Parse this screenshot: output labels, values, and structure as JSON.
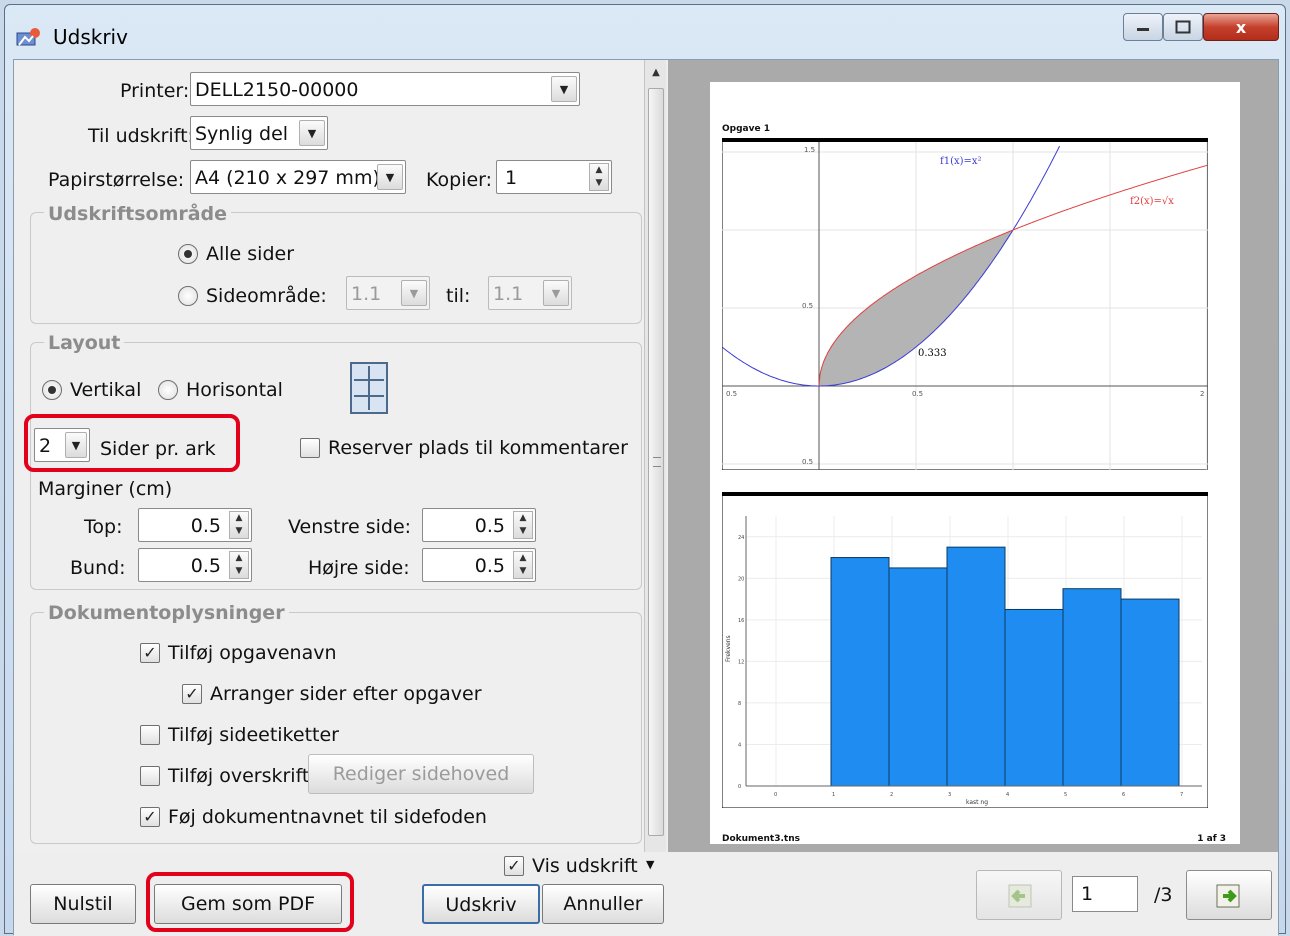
{
  "window": {
    "title": "Udskriv",
    "close_glyph": "x"
  },
  "printer": {
    "label": "Printer:",
    "value": "DELL2150-00000"
  },
  "print_what": {
    "label": "Til udskrift:",
    "value": "Synlig del"
  },
  "paper": {
    "label": "Papirstørrelse:",
    "value": "A4 (210 x 297 mm)"
  },
  "copies": {
    "label": "Kopier:",
    "value": "1"
  },
  "print_range": {
    "title": "Udskriftsområde",
    "all_pages": "Alle sider",
    "page_range": "Sideområde:",
    "from": "1.1",
    "to_label": "til:",
    "to": "1.1",
    "selected": "all"
  },
  "layout": {
    "title": "Layout",
    "portrait": "Vertikal",
    "landscape": "Horisontal",
    "orientation": "portrait",
    "pages_per_sheet": "2",
    "pages_per_sheet_label": "Sider pr. ark",
    "reserve_comments": "Reserver plads til kommentarer",
    "reserve_checked": false,
    "margins_title": "Marginer (cm)",
    "top_label": "Top:",
    "top": "0.5",
    "bottom_label": "Bund:",
    "bottom": "0.5",
    "left_label": "Venstre side:",
    "left": "0.5",
    "right_label": "Højre side:",
    "right": "0.5"
  },
  "doc_info": {
    "title": "Dokumentoplysninger",
    "add_task_name": {
      "label": "Tilføj opgavenavn",
      "checked": true
    },
    "arrange_pages": {
      "label": "Arranger sider efter opgaver",
      "checked": true
    },
    "add_labels": {
      "label": "Tilføj sideetiketter",
      "checked": false
    },
    "add_header": {
      "label": "Tilføj overskrift",
      "checked": false
    },
    "edit_header": "Rediger sidehoved",
    "add_docname": {
      "label": "Føj dokumentnavnet til sidefoden",
      "checked": true
    }
  },
  "show_preview": {
    "label": "Vis udskrift",
    "checked": true
  },
  "buttons": {
    "reset": "Nulstil",
    "save_pdf": "Gem som PDF",
    "print": "Udskriv",
    "cancel": "Annuller"
  },
  "preview": {
    "page_input": "1",
    "page_total": "/3",
    "page_title": "Opgave 1",
    "footer_left": "Dokument3.tns",
    "footer_right": "1 af 3",
    "graph": {
      "f1_label": "f1(x)=x²",
      "f2_label": "f2(x)=√x",
      "area_label": "0.333",
      "y_ticks": [
        "1.5",
        "0.5",
        "0.5"
      ],
      "x_ticks": [
        "0.5",
        "0.5",
        "2"
      ],
      "color_f1": "#3b3bd6",
      "color_f2": "#e04040",
      "shade": "#b4b4b4"
    },
    "histogram": {
      "values": [
        22,
        21,
        23,
        17,
        19,
        18
      ],
      "ymax": 26,
      "y_ticks": [
        "24",
        "20",
        "16",
        "12",
        "8",
        "4",
        "0"
      ],
      "x_ticks": [
        "0",
        "1",
        "2",
        "3",
        "4",
        "5",
        "6",
        "7"
      ],
      "ylabel": "Frekvens",
      "xlabel": "kast ng",
      "bar_color": "#1e8cf0"
    }
  },
  "colors": {
    "highlight": "#e2001a"
  }
}
